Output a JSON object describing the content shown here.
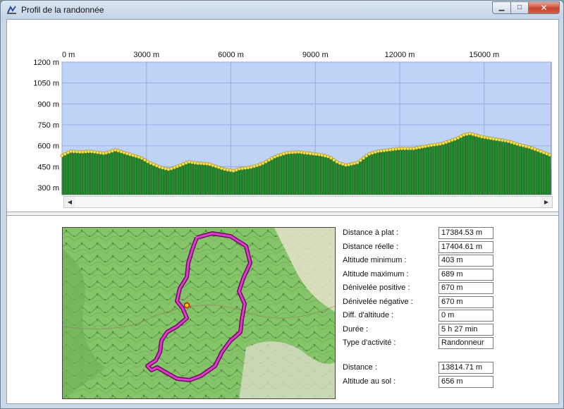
{
  "window": {
    "title": "Profil de la randonnée",
    "min_glyph": "▁",
    "max_glyph": "□",
    "close_glyph": "✕"
  },
  "colors": {
    "sky": "#bfd3f7",
    "grid": "#98aee0",
    "terrain_dark": "#1d5a20",
    "terrain": "#2f9a3a",
    "point": "#f0e050",
    "route": "#e03ccb"
  },
  "chart_data": {
    "type": "area",
    "title": "",
    "xlabel": "",
    "ylabel": "",
    "x_ticks": [
      "0 m",
      "3000 m",
      "6000 m",
      "9000 m",
      "12000 m",
      "15000 m"
    ],
    "y_ticks": [
      "1200 m",
      "1050 m",
      "900 m",
      "750 m",
      "600 m",
      "450 m",
      "300 m"
    ],
    "xlim": [
      0,
      17384.53
    ],
    "ylim": [
      250,
      1200
    ],
    "grid": true,
    "series": [
      {
        "x": [
          0,
          300,
          700,
          1000,
          1500,
          1900,
          2300,
          2800,
          3100,
          3500,
          3800,
          4200,
          4500,
          4800,
          5200,
          5500,
          5800,
          6100,
          6300,
          6700,
          7100,
          7600,
          8000,
          8400,
          8800,
          9200,
          9500,
          9800,
          10100,
          10500,
          10900,
          11200,
          11600,
          12000,
          12500,
          13000,
          13500,
          14000,
          14300,
          14500,
          14900,
          15300,
          15800,
          16200,
          16600,
          17000,
          17384
        ],
        "y": [
          530,
          560,
          555,
          560,
          545,
          570,
          545,
          515,
          480,
          445,
          430,
          460,
          485,
          475,
          470,
          450,
          430,
          420,
          435,
          445,
          470,
          525,
          550,
          555,
          545,
          535,
          520,
          480,
          460,
          480,
          540,
          560,
          570,
          580,
          580,
          600,
          615,
          650,
          680,
          687,
          665,
          650,
          635,
          610,
          590,
          560,
          530
        ]
      }
    ]
  },
  "scrollbar": {
    "left_arrow": "◀",
    "right_arrow": "▶"
  },
  "map": {
    "route": [
      [
        190,
        14
      ],
      [
        212,
        8
      ],
      [
        238,
        12
      ],
      [
        260,
        26
      ],
      [
        266,
        50
      ],
      [
        256,
        72
      ],
      [
        250,
        90
      ],
      [
        258,
        108
      ],
      [
        254,
        130
      ],
      [
        252,
        148
      ],
      [
        238,
        160
      ],
      [
        226,
        176
      ],
      [
        216,
        196
      ],
      [
        196,
        210
      ],
      [
        180,
        216
      ],
      [
        162,
        214
      ],
      [
        148,
        206
      ],
      [
        134,
        198
      ],
      [
        126,
        202
      ],
      [
        120,
        196
      ],
      [
        132,
        188
      ],
      [
        138,
        176
      ],
      [
        140,
        160
      ],
      [
        148,
        148
      ],
      [
        162,
        140
      ],
      [
        176,
        128
      ],
      [
        170,
        114
      ],
      [
        162,
        104
      ],
      [
        166,
        86
      ],
      [
        176,
        70
      ],
      [
        178,
        50
      ],
      [
        184,
        30
      ],
      [
        190,
        14
      ]
    ],
    "marker": [
      176,
      110
    ]
  },
  "stats": [
    {
      "label": "Distance à plat :",
      "value": "17384.53 m"
    },
    {
      "label": "Distance réelle :",
      "value": "17404.61 m"
    },
    {
      "label": "Altitude minimum :",
      "value": "403 m"
    },
    {
      "label": "Altitude maximum :",
      "value": "689 m"
    },
    {
      "label": "Dénivelée positive :",
      "value": "670 m"
    },
    {
      "label": "Dénivelée négative :",
      "value": "670 m"
    },
    {
      "label": "Diff. d'altitude :",
      "value": "0 m"
    },
    {
      "label": "Durée :",
      "value": "5 h 27 min"
    },
    {
      "label": "Type d'activité :",
      "value": "Randonneur"
    }
  ],
  "cursor_stats": [
    {
      "label": "Distance :",
      "value": "13814.71 m"
    },
    {
      "label": "Altitude au sol :",
      "value": "656 m"
    }
  ]
}
